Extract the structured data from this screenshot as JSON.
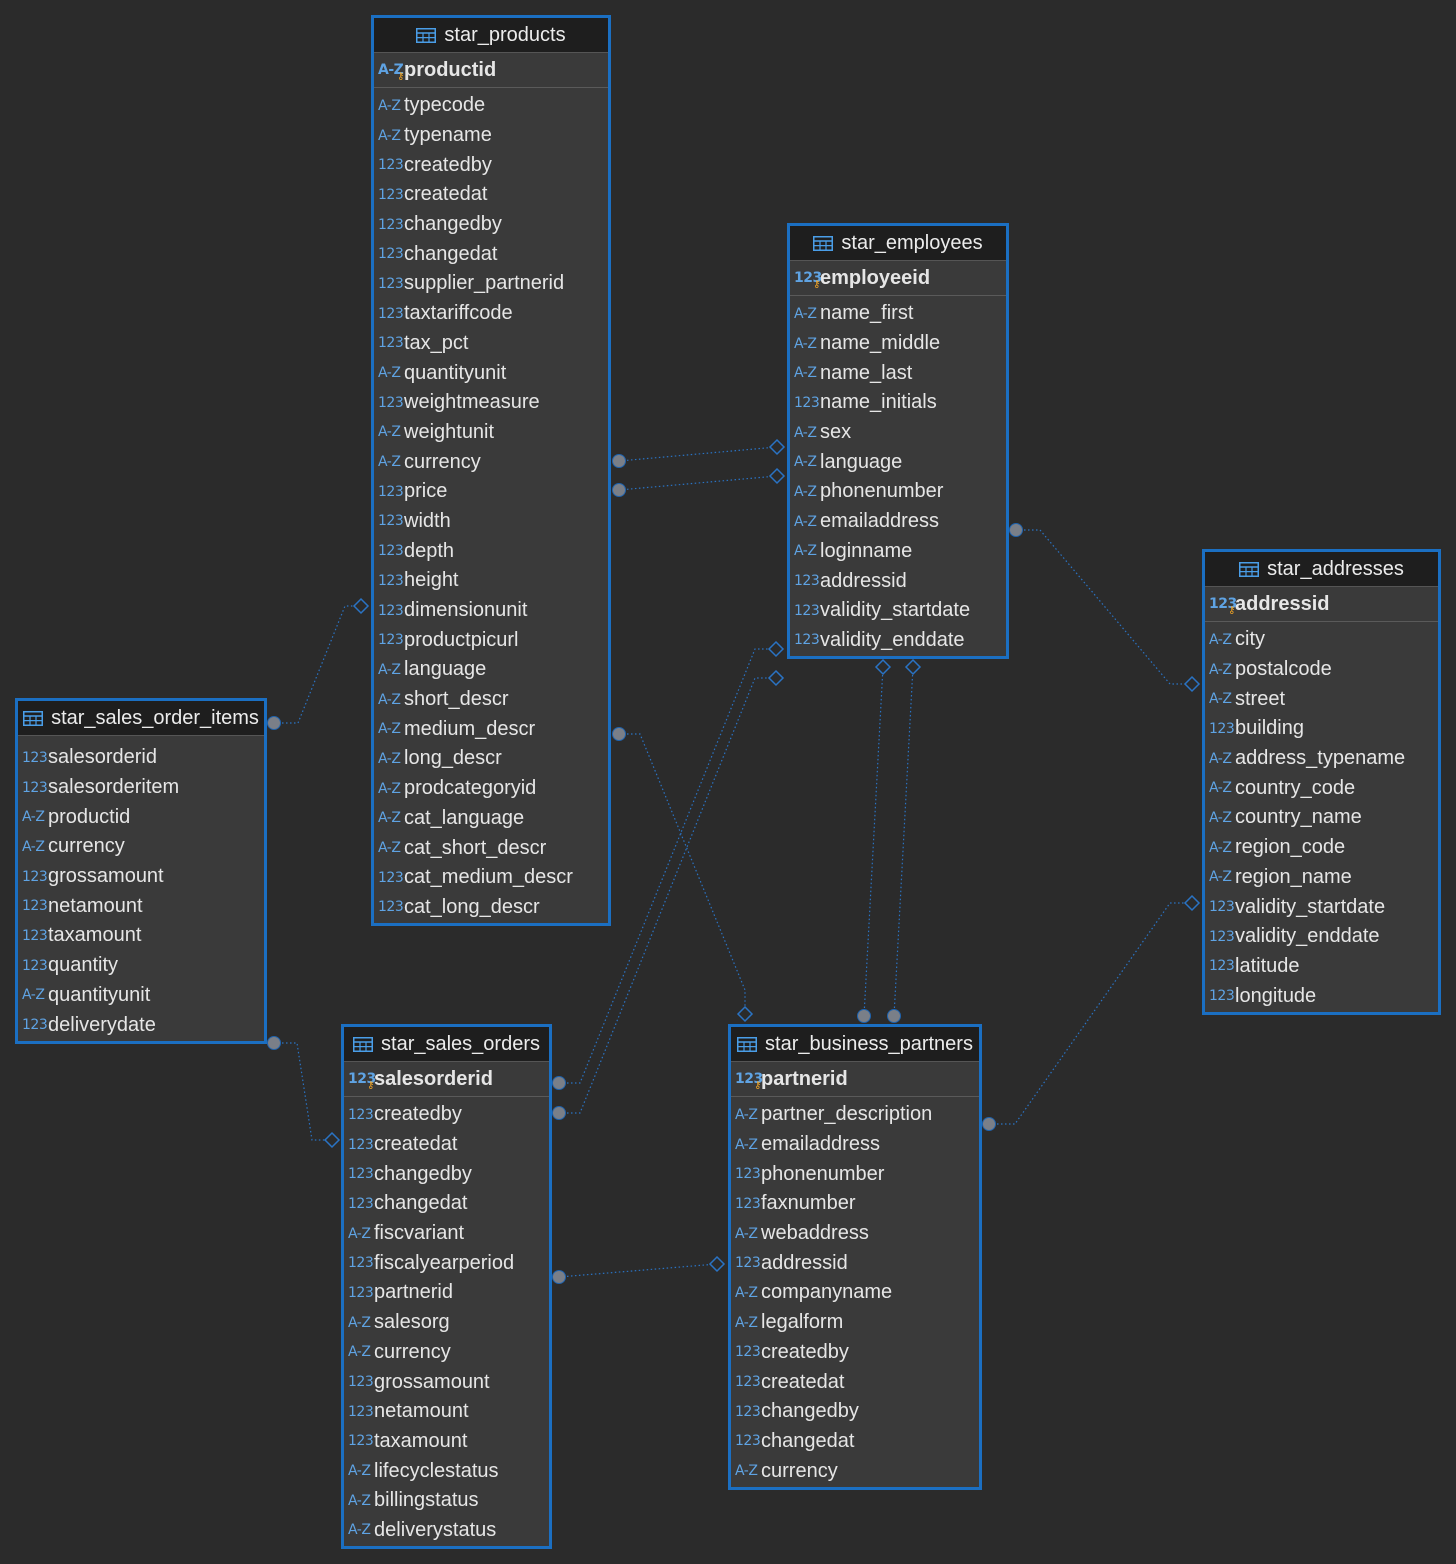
{
  "colors": {
    "background": "#2b2b2b",
    "table_border": "#1b6fc2",
    "type_icon": "#5fa3e3",
    "key_icon": "#f5a623"
  },
  "icons": {
    "table": "table-grid-icon",
    "text_type": "A-Z",
    "numeric_type": "123",
    "key": "key-icon"
  },
  "tables": [
    {
      "name": "star_products",
      "pk": {
        "type": "A-Z",
        "name": "productid"
      },
      "columns": [
        {
          "type": "A-Z",
          "name": "typecode"
        },
        {
          "type": "A-Z",
          "name": "typename"
        },
        {
          "type": "123",
          "name": "createdby"
        },
        {
          "type": "123",
          "name": "createdat"
        },
        {
          "type": "123",
          "name": "changedby"
        },
        {
          "type": "123",
          "name": "changedat"
        },
        {
          "type": "123",
          "name": "supplier_partnerid"
        },
        {
          "type": "123",
          "name": "taxtariffcode"
        },
        {
          "type": "123",
          "name": "tax_pct"
        },
        {
          "type": "A-Z",
          "name": "quantityunit"
        },
        {
          "type": "123",
          "name": "weightmeasure"
        },
        {
          "type": "A-Z",
          "name": "weightunit"
        },
        {
          "type": "A-Z",
          "name": "currency"
        },
        {
          "type": "123",
          "name": "price"
        },
        {
          "type": "123",
          "name": "width"
        },
        {
          "type": "123",
          "name": "depth"
        },
        {
          "type": "123",
          "name": "height"
        },
        {
          "type": "123",
          "name": "dimensionunit"
        },
        {
          "type": "123",
          "name": "productpicurl"
        },
        {
          "type": "A-Z",
          "name": "language"
        },
        {
          "type": "A-Z",
          "name": "short_descr"
        },
        {
          "type": "A-Z",
          "name": "medium_descr"
        },
        {
          "type": "A-Z",
          "name": "long_descr"
        },
        {
          "type": "A-Z",
          "name": "prodcategoryid"
        },
        {
          "type": "A-Z",
          "name": "cat_language"
        },
        {
          "type": "A-Z",
          "name": "cat_short_descr"
        },
        {
          "type": "123",
          "name": "cat_medium_descr"
        },
        {
          "type": "123",
          "name": "cat_long_descr"
        }
      ]
    },
    {
      "name": "star_employees",
      "pk": {
        "type": "123",
        "name": "employeeid"
      },
      "columns": [
        {
          "type": "A-Z",
          "name": "name_first"
        },
        {
          "type": "A-Z",
          "name": "name_middle"
        },
        {
          "type": "A-Z",
          "name": "name_last"
        },
        {
          "type": "123",
          "name": "name_initials"
        },
        {
          "type": "A-Z",
          "name": "sex"
        },
        {
          "type": "A-Z",
          "name": "language"
        },
        {
          "type": "A-Z",
          "name": "phonenumber"
        },
        {
          "type": "A-Z",
          "name": "emailaddress"
        },
        {
          "type": "A-Z",
          "name": "loginname"
        },
        {
          "type": "123",
          "name": "addressid"
        },
        {
          "type": "123",
          "name": "validity_startdate"
        },
        {
          "type": "123",
          "name": "validity_enddate"
        }
      ]
    },
    {
      "name": "star_addresses",
      "pk": {
        "type": "123",
        "name": "addressid"
      },
      "columns": [
        {
          "type": "A-Z",
          "name": "city"
        },
        {
          "type": "A-Z",
          "name": "postalcode"
        },
        {
          "type": "A-Z",
          "name": "street"
        },
        {
          "type": "123",
          "name": "building"
        },
        {
          "type": "A-Z",
          "name": "address_typename"
        },
        {
          "type": "A-Z",
          "name": "country_code"
        },
        {
          "type": "A-Z",
          "name": "country_name"
        },
        {
          "type": "A-Z",
          "name": "region_code"
        },
        {
          "type": "A-Z",
          "name": "region_name"
        },
        {
          "type": "123",
          "name": "validity_startdate"
        },
        {
          "type": "123",
          "name": "validity_enddate"
        },
        {
          "type": "123",
          "name": "latitude"
        },
        {
          "type": "123",
          "name": "longitude"
        }
      ]
    },
    {
      "name": "star_sales_order_items",
      "pk": null,
      "columns": [
        {
          "type": "123",
          "name": "salesorderid"
        },
        {
          "type": "123",
          "name": "salesorderitem"
        },
        {
          "type": "A-Z",
          "name": "productid"
        },
        {
          "type": "A-Z",
          "name": "currency"
        },
        {
          "type": "123",
          "name": "grossamount"
        },
        {
          "type": "123",
          "name": "netamount"
        },
        {
          "type": "123",
          "name": "taxamount"
        },
        {
          "type": "123",
          "name": "quantity"
        },
        {
          "type": "A-Z",
          "name": "quantityunit"
        },
        {
          "type": "123",
          "name": "deliverydate"
        }
      ]
    },
    {
      "name": "star_sales_orders",
      "pk": {
        "type": "123",
        "name": "salesorderid"
      },
      "columns": [
        {
          "type": "123",
          "name": "createdby"
        },
        {
          "type": "123",
          "name": "createdat"
        },
        {
          "type": "123",
          "name": "changedby"
        },
        {
          "type": "123",
          "name": "changedat"
        },
        {
          "type": "A-Z",
          "name": "fiscvariant"
        },
        {
          "type": "123",
          "name": "fiscalyearperiod"
        },
        {
          "type": "123",
          "name": "partnerid"
        },
        {
          "type": "A-Z",
          "name": "salesorg"
        },
        {
          "type": "A-Z",
          "name": "currency"
        },
        {
          "type": "123",
          "name": "grossamount"
        },
        {
          "type": "123",
          "name": "netamount"
        },
        {
          "type": "123",
          "name": "taxamount"
        },
        {
          "type": "A-Z",
          "name": "lifecyclestatus"
        },
        {
          "type": "A-Z",
          "name": "billingstatus"
        },
        {
          "type": "A-Z",
          "name": "deliverystatus"
        }
      ]
    },
    {
      "name": "star_business_partners",
      "pk": {
        "type": "123",
        "name": "partnerid"
      },
      "columns": [
        {
          "type": "A-Z",
          "name": "partner_description"
        },
        {
          "type": "A-Z",
          "name": "emailaddress"
        },
        {
          "type": "123",
          "name": "phonenumber"
        },
        {
          "type": "123",
          "name": "faxnumber"
        },
        {
          "type": "A-Z",
          "name": "webaddress"
        },
        {
          "type": "123",
          "name": "addressid"
        },
        {
          "type": "A-Z",
          "name": "companyname"
        },
        {
          "type": "A-Z",
          "name": "legalform"
        },
        {
          "type": "123",
          "name": "createdby"
        },
        {
          "type": "123",
          "name": "createdat"
        },
        {
          "type": "123",
          "name": "changedby"
        },
        {
          "type": "123",
          "name": "changedat"
        },
        {
          "type": "A-Z",
          "name": "currency"
        }
      ]
    }
  ]
}
